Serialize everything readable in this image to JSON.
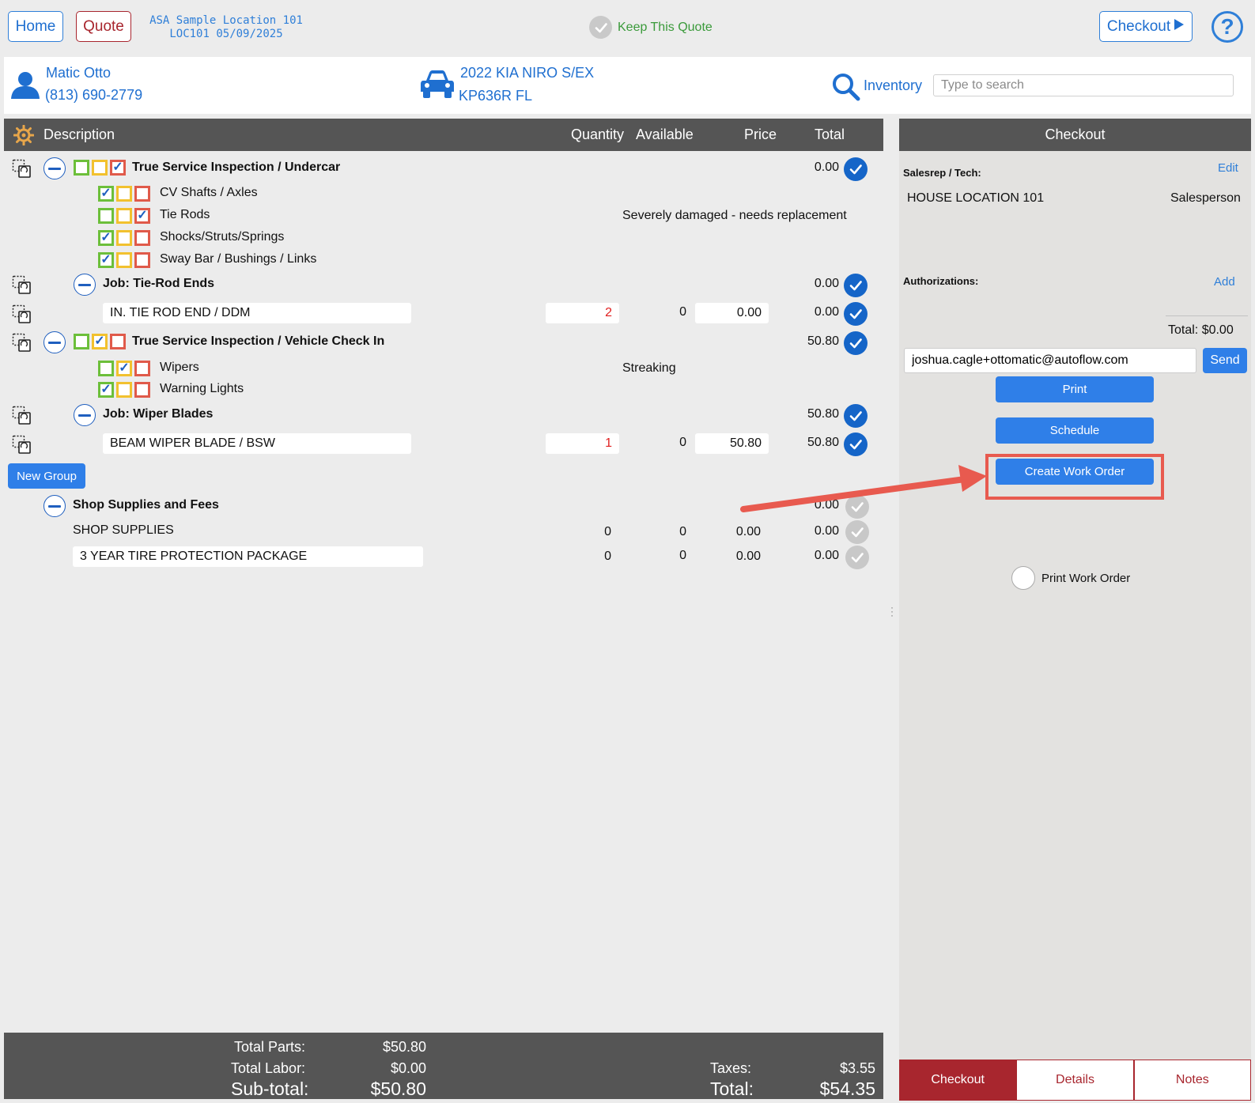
{
  "topbar": {
    "home_label": "Home",
    "quote_label": "Quote",
    "location_line1": "ASA Sample Location 101",
    "location_line2": "LOC101 05/09/2025",
    "keep_quote_label": "Keep This Quote",
    "checkout_label": "Checkout",
    "help_label": "?"
  },
  "customer": {
    "name": "Matic Otto",
    "phone": "(813) 690-2779"
  },
  "vehicle": {
    "name": "2022 KIA NIRO S/EX",
    "plate": "KP636R FL"
  },
  "inventory": {
    "label": "Inventory",
    "search_placeholder": "Type to search"
  },
  "table": {
    "headers": {
      "description": "Description",
      "quantity": "Quantity",
      "available": "Available",
      "price": "Price",
      "total": "Total"
    },
    "inspection1": {
      "title": "True Service Inspection / Undercar",
      "total": "0.00",
      "items": [
        {
          "label": "CV Shafts / Axles",
          "note": ""
        },
        {
          "label": "Tie Rods",
          "note": "Severely damaged - needs replacement"
        },
        {
          "label": "Shocks/Struts/Springs",
          "note": ""
        },
        {
          "label": "Sway Bar / Bushings / Links",
          "note": ""
        }
      ]
    },
    "job1": {
      "title": "Job: Tie-Rod Ends",
      "total": "0.00",
      "part": {
        "description": "IN. TIE ROD END / DDM",
        "quantity": "2",
        "available": "0",
        "price": "0.00",
        "total": "0.00"
      }
    },
    "inspection2": {
      "title": "True Service Inspection / Vehicle Check In",
      "total": "50.80",
      "items": [
        {
          "label": "Wipers",
          "note": "Streaking"
        },
        {
          "label": "Warning Lights",
          "note": ""
        }
      ]
    },
    "job2": {
      "title": "Job: Wiper Blades",
      "total": "50.80",
      "part": {
        "description": "BEAM WIPER BLADE / BSW",
        "quantity": "1",
        "available": "0",
        "price": "50.80",
        "total": "50.80"
      }
    },
    "new_group_label": "New Group",
    "shop": {
      "title": "Shop Supplies and Fees",
      "total": "0.00",
      "rows": [
        {
          "description": "SHOP SUPPLIES",
          "quantity": "0",
          "available": "0",
          "price": "0.00",
          "total": "0.00"
        },
        {
          "description": "3 YEAR TIRE PROTECTION PACKAGE",
          "quantity": "0",
          "available": "0",
          "price": "0.00",
          "total": "0.00"
        }
      ]
    }
  },
  "totals": {
    "parts_label": "Total Parts:",
    "parts_value": "$50.80",
    "labor_label": "Total Labor:",
    "labor_value": "$0.00",
    "subtotal_label": "Sub-total:",
    "subtotal_value": "$50.80",
    "taxes_label": "Taxes:",
    "taxes_value": "$3.55",
    "total_label": "Total:",
    "total_value": "$54.35"
  },
  "checkout": {
    "title": "Checkout",
    "salesrep_label": "Salesrep / Tech:",
    "edit_label": "Edit",
    "salesrep_name": "HOUSE LOCATION 101",
    "salesrep_role": "Salesperson",
    "authorizations_label": "Authorizations:",
    "add_label": "Add",
    "total_text": "Total: $0.00",
    "email_value": "joshua.cagle+ottomatic@autoflow.com",
    "send_label": "Send",
    "print_label": "Print",
    "schedule_label": "Schedule",
    "create_wo_label": "Create Work Order",
    "print_wo_label": "Print Work Order"
  },
  "tabs": [
    "Checkout",
    "Details",
    "Notes"
  ],
  "colors": {
    "accent_blue": "#2f7fe8",
    "brand_red": "#a8262e",
    "header_grey": "#555555",
    "highlight": "#e85a4f"
  }
}
